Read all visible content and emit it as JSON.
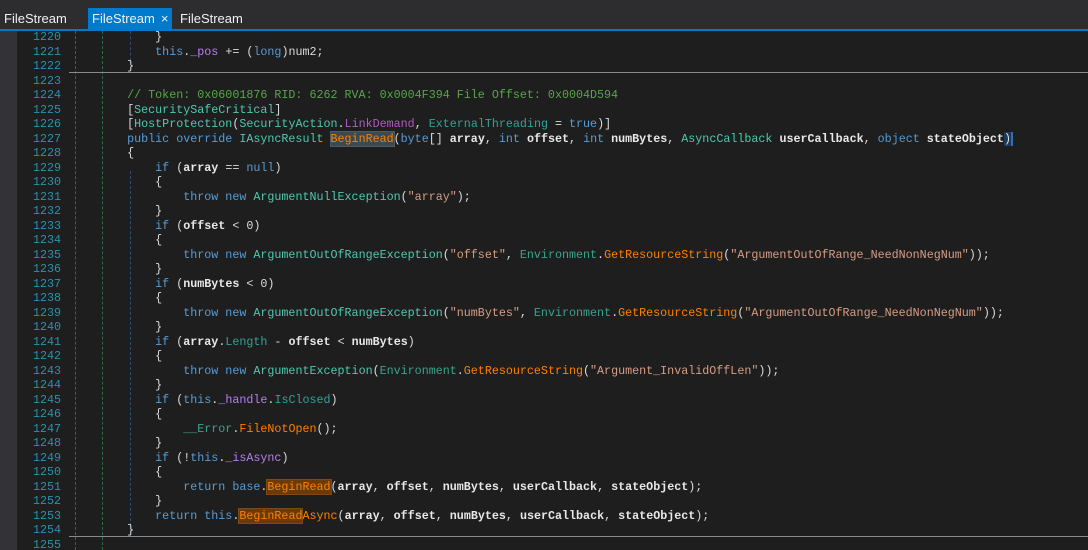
{
  "tabs": [
    {
      "label": "FileStream",
      "active": false
    },
    {
      "label": "FileStream",
      "active": true,
      "close": "×"
    },
    {
      "label": "FileStream",
      "active": false
    }
  ],
  "colors": {
    "accent": "#007acc",
    "background": "#1e1e1e",
    "line_numbers": "#2b91af"
  },
  "lines": [
    {
      "n": "1220",
      "t": [
        [
          "p",
          "            }"
        ]
      ]
    },
    {
      "n": "1221",
      "t": [
        [
          "p",
          "            "
        ],
        [
          "kw",
          "this"
        ],
        [
          "p",
          "."
        ],
        [
          "field",
          "_pos"
        ],
        [
          "p",
          " += ("
        ],
        [
          "kw",
          "long"
        ],
        [
          "p",
          ")num2;"
        ]
      ]
    },
    {
      "n": "1222",
      "t": [
        [
          "p",
          "        }"
        ]
      ],
      "sep": true
    },
    {
      "n": "1223",
      "t": []
    },
    {
      "n": "1224",
      "t": [
        [
          "p",
          "        "
        ],
        [
          "cm",
          "// Token: 0x06001876 RID: 6262 RVA: 0x0004F394 File Offset: 0x0004D594"
        ]
      ]
    },
    {
      "n": "1225",
      "t": [
        [
          "p",
          "        ["
        ],
        [
          "type",
          "SecuritySafeCritical"
        ],
        [
          "p",
          "]"
        ]
      ]
    },
    {
      "n": "1226",
      "t": [
        [
          "p",
          "        ["
        ],
        [
          "type",
          "HostProtection"
        ],
        [
          "p",
          "("
        ],
        [
          "type",
          "SecurityAction"
        ],
        [
          "p",
          "."
        ],
        [
          "enumv",
          "LinkDemand"
        ],
        [
          "p",
          ", "
        ],
        [
          "prop",
          "ExternalThreading"
        ],
        [
          "p",
          " = "
        ],
        [
          "kw",
          "true"
        ],
        [
          "p",
          ")]"
        ]
      ]
    },
    {
      "n": "1227",
      "t": [
        [
          "p",
          "        "
        ],
        [
          "kw",
          "public override "
        ],
        [
          "type",
          "IAsyncResult"
        ],
        [
          "p",
          " "
        ],
        [
          "method hlg",
          "BeginRead"
        ],
        [
          "p",
          "("
        ],
        [
          "kw",
          "byte"
        ],
        [
          "p",
          "[] "
        ],
        [
          "param",
          "array"
        ],
        [
          "p",
          ", "
        ],
        [
          "kw",
          "int"
        ],
        [
          "p",
          " "
        ],
        [
          "param",
          "offset"
        ],
        [
          "p",
          ", "
        ],
        [
          "kw",
          "int"
        ],
        [
          "p",
          " "
        ],
        [
          "param",
          "numBytes"
        ],
        [
          "p",
          ", "
        ],
        [
          "type",
          "AsyncCallback"
        ],
        [
          "p",
          " "
        ],
        [
          "param",
          "userCallback"
        ],
        [
          "p",
          ", "
        ],
        [
          "kw",
          "object"
        ],
        [
          "p",
          " "
        ],
        [
          "param",
          "stateObject"
        ],
        [
          "p caret",
          ")"
        ]
      ]
    },
    {
      "n": "1228",
      "t": [
        [
          "p",
          "        {"
        ]
      ]
    },
    {
      "n": "1229",
      "t": [
        [
          "p",
          "            "
        ],
        [
          "kw",
          "if"
        ],
        [
          "p",
          " ("
        ],
        [
          "param",
          "array"
        ],
        [
          "p",
          " == "
        ],
        [
          "kw",
          "null"
        ],
        [
          "p",
          ")"
        ]
      ]
    },
    {
      "n": "1230",
      "t": [
        [
          "p",
          "            {"
        ]
      ]
    },
    {
      "n": "1231",
      "t": [
        [
          "p",
          "                "
        ],
        [
          "kw",
          "throw new "
        ],
        [
          "type",
          "ArgumentNullException"
        ],
        [
          "p",
          "("
        ],
        [
          "str",
          "\"array\""
        ],
        [
          "p",
          ");"
        ]
      ]
    },
    {
      "n": "1232",
      "t": [
        [
          "p",
          "            }"
        ]
      ]
    },
    {
      "n": "1233",
      "t": [
        [
          "p",
          "            "
        ],
        [
          "kw",
          "if"
        ],
        [
          "p",
          " ("
        ],
        [
          "param",
          "offset"
        ],
        [
          "p",
          " < 0)"
        ]
      ]
    },
    {
      "n": "1234",
      "t": [
        [
          "p",
          "            {"
        ]
      ]
    },
    {
      "n": "1235",
      "t": [
        [
          "p",
          "                "
        ],
        [
          "kw",
          "throw new "
        ],
        [
          "type",
          "ArgumentOutOfRangeException"
        ],
        [
          "p",
          "("
        ],
        [
          "str",
          "\"offset\""
        ],
        [
          "p",
          ", "
        ],
        [
          "stype",
          "Environment"
        ],
        [
          "p",
          "."
        ],
        [
          "method",
          "GetResourceString"
        ],
        [
          "p",
          "("
        ],
        [
          "str",
          "\"ArgumentOutOfRange_NeedNonNegNum\""
        ],
        [
          "p",
          "));"
        ]
      ]
    },
    {
      "n": "1236",
      "t": [
        [
          "p",
          "            }"
        ]
      ]
    },
    {
      "n": "1237",
      "t": [
        [
          "p",
          "            "
        ],
        [
          "kw",
          "if"
        ],
        [
          "p",
          " ("
        ],
        [
          "param",
          "numBytes"
        ],
        [
          "p",
          " < 0)"
        ]
      ]
    },
    {
      "n": "1238",
      "t": [
        [
          "p",
          "            {"
        ]
      ]
    },
    {
      "n": "1239",
      "t": [
        [
          "p",
          "                "
        ],
        [
          "kw",
          "throw new "
        ],
        [
          "type",
          "ArgumentOutOfRangeException"
        ],
        [
          "p",
          "("
        ],
        [
          "str",
          "\"numBytes\""
        ],
        [
          "p",
          ", "
        ],
        [
          "stype",
          "Environment"
        ],
        [
          "p",
          "."
        ],
        [
          "method",
          "GetResourceString"
        ],
        [
          "p",
          "("
        ],
        [
          "str",
          "\"ArgumentOutOfRange_NeedNonNegNum\""
        ],
        [
          "p",
          "));"
        ]
      ]
    },
    {
      "n": "1240",
      "t": [
        [
          "p",
          "            }"
        ]
      ]
    },
    {
      "n": "1241",
      "t": [
        [
          "p",
          "            "
        ],
        [
          "kw",
          "if"
        ],
        [
          "p",
          " ("
        ],
        [
          "param",
          "array"
        ],
        [
          "p",
          "."
        ],
        [
          "prop",
          "Length"
        ],
        [
          "p",
          " - "
        ],
        [
          "param",
          "offset"
        ],
        [
          "p",
          " < "
        ],
        [
          "param",
          "numBytes"
        ],
        [
          "p",
          ")"
        ]
      ]
    },
    {
      "n": "1242",
      "t": [
        [
          "p",
          "            {"
        ]
      ]
    },
    {
      "n": "1243",
      "t": [
        [
          "p",
          "                "
        ],
        [
          "kw",
          "throw new "
        ],
        [
          "type",
          "ArgumentException"
        ],
        [
          "p",
          "("
        ],
        [
          "stype",
          "Environment"
        ],
        [
          "p",
          "."
        ],
        [
          "method",
          "GetResourceString"
        ],
        [
          "p",
          "("
        ],
        [
          "str",
          "\"Argument_InvalidOffLen\""
        ],
        [
          "p",
          "));"
        ]
      ]
    },
    {
      "n": "1244",
      "t": [
        [
          "p",
          "            }"
        ]
      ]
    },
    {
      "n": "1245",
      "t": [
        [
          "p",
          "            "
        ],
        [
          "kw",
          "if"
        ],
        [
          "p",
          " ("
        ],
        [
          "kw",
          "this"
        ],
        [
          "p",
          "."
        ],
        [
          "field",
          "_handle"
        ],
        [
          "p",
          "."
        ],
        [
          "prop",
          "IsClosed"
        ],
        [
          "p",
          ")"
        ]
      ]
    },
    {
      "n": "1246",
      "t": [
        [
          "p",
          "            {"
        ]
      ]
    },
    {
      "n": "1247",
      "t": [
        [
          "p",
          "                "
        ],
        [
          "stype",
          "__Error"
        ],
        [
          "p",
          "."
        ],
        [
          "method",
          "FileNotOpen"
        ],
        [
          "p",
          "();"
        ]
      ]
    },
    {
      "n": "1248",
      "t": [
        [
          "p",
          "            }"
        ]
      ]
    },
    {
      "n": "1249",
      "t": [
        [
          "p",
          "            "
        ],
        [
          "kw",
          "if"
        ],
        [
          "p",
          " (!"
        ],
        [
          "kw",
          "this"
        ],
        [
          "p",
          "."
        ],
        [
          "field",
          "_isAsync"
        ],
        [
          "p",
          ")"
        ]
      ]
    },
    {
      "n": "1250",
      "t": [
        [
          "p",
          "            {"
        ]
      ]
    },
    {
      "n": "1251",
      "t": [
        [
          "p",
          "                "
        ],
        [
          "kw",
          "return base"
        ],
        [
          "p",
          "."
        ],
        [
          "method hl",
          "BeginRead"
        ],
        [
          "p",
          "("
        ],
        [
          "param",
          "array"
        ],
        [
          "p",
          ", "
        ],
        [
          "param",
          "offset"
        ],
        [
          "p",
          ", "
        ],
        [
          "param",
          "numBytes"
        ],
        [
          "p",
          ", "
        ],
        [
          "param",
          "userCallback"
        ],
        [
          "p",
          ", "
        ],
        [
          "param",
          "stateObject"
        ],
        [
          "p",
          ");"
        ]
      ]
    },
    {
      "n": "1252",
      "t": [
        [
          "p",
          "            }"
        ]
      ]
    },
    {
      "n": "1253",
      "t": [
        [
          "p",
          "            "
        ],
        [
          "kw",
          "return this"
        ],
        [
          "p",
          "."
        ],
        [
          "method hl",
          "BeginRead"
        ],
        [
          "method",
          "Async"
        ],
        [
          "p",
          "("
        ],
        [
          "param",
          "array"
        ],
        [
          "p",
          ", "
        ],
        [
          "param",
          "offset"
        ],
        [
          "p",
          ", "
        ],
        [
          "param",
          "numBytes"
        ],
        [
          "p",
          ", "
        ],
        [
          "param",
          "userCallback"
        ],
        [
          "p",
          ", "
        ],
        [
          "param",
          "stateObject"
        ],
        [
          "p",
          ");"
        ]
      ]
    },
    {
      "n": "1254",
      "t": [
        [
          "p",
          "        }"
        ]
      ],
      "sep": true
    },
    {
      "n": "1255",
      "t": []
    }
  ]
}
